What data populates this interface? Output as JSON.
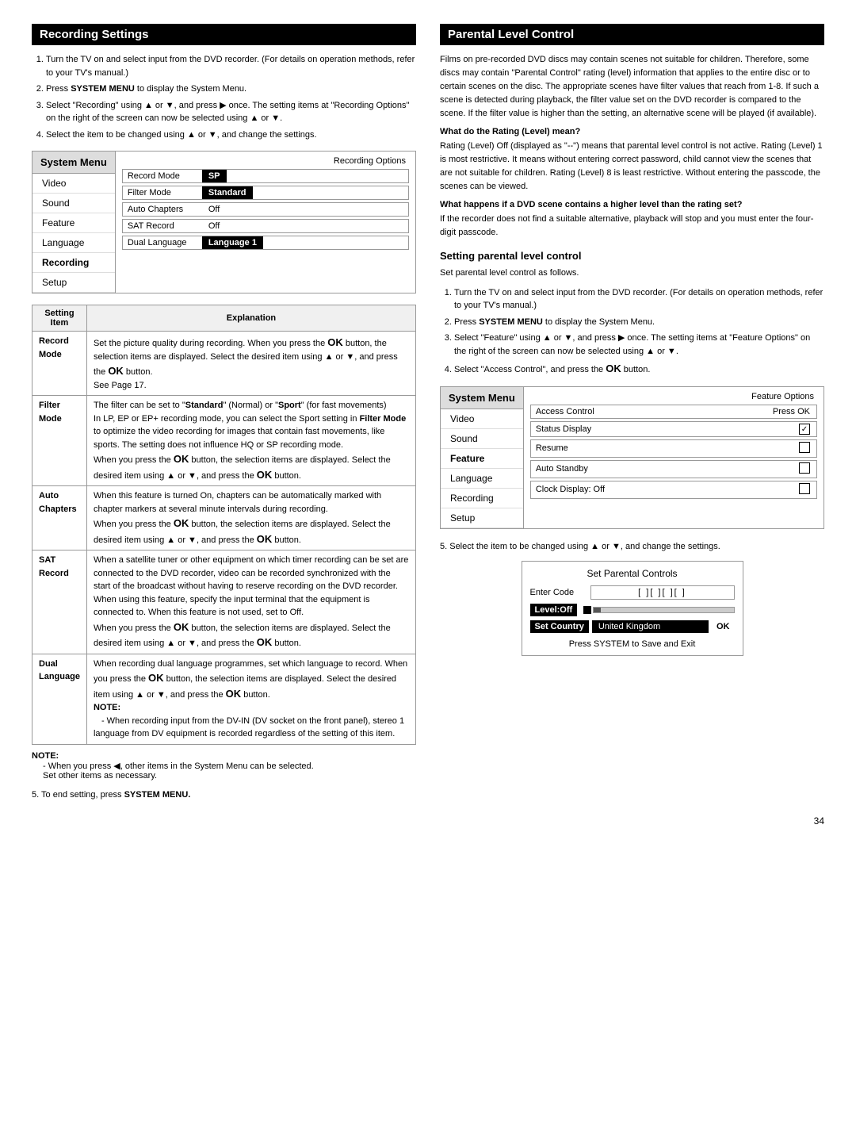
{
  "left": {
    "section_title": "Recording Settings",
    "steps": [
      "Turn the TV on and select input from the DVD recorder. (For details on operation methods, refer to your TV's manual.)",
      "Press SYSTEM MENU to display the System Menu.",
      "Select \"Recording\" using ▲ or ▼, and press ▶ once. The setting items at \"Recording Options\" on the right of the screen can now be selected using ▲ or ▼.",
      "Select the item to be changed using ▲ or ▼, and change the settings."
    ],
    "system_menu": {
      "title": "System Menu",
      "items": [
        "Video",
        "Sound",
        "Feature",
        "Language",
        "Recording",
        "Setup"
      ],
      "selected": "Recording",
      "options_title": "Recording Options",
      "options": [
        {
          "label": "Record Mode",
          "value": "SP",
          "highlighted": true
        },
        {
          "label": "Filter Mode",
          "value": "Standard",
          "highlighted": true
        },
        {
          "label": "Auto Chapters",
          "value": "Off",
          "highlighted": false
        },
        {
          "label": "SAT Record",
          "value": "Off",
          "highlighted": false
        },
        {
          "label": "Dual Language",
          "value": "Language 1",
          "highlighted": true
        }
      ]
    },
    "table": {
      "col1": "Setting Item",
      "col2": "Explanation",
      "rows": [
        {
          "item": "Record Mode",
          "explanation": "Set the picture quality during recording. When you press the OK button, the selection items are displayed. Select the desired item using ▲ or ▼, and press the OK button.\nSee Page 17."
        },
        {
          "item": "Filter Mode",
          "explanation": "The filter can be set to \"Standard\" (Normal) or \"Sport\" (for fast movements)\nIn LP, EP or EP+ recording mode, you can select the Sport setting in Filter Mode to optimize the video recording for images that contain fast movements, like sports. The setting does not influence HQ or SP recording mode.\nWhen you press the OK button, the selection items are displayed. Select the desired item using ▲ or ▼, and press the OK button."
        },
        {
          "item": "Auto Chapters",
          "explanation": "When this feature is turned On, chapters can be automatically marked with chapter markers at several minute intervals during recording.\nWhen you press the OK button, the selection items are displayed. Select the desired item using ▲ or ▼, and press the OK button."
        },
        {
          "item": "SAT Record",
          "explanation": "When a satellite tuner or other equipment on which timer recording can be set are connected to the DVD recorder, video can be recorded synchronized with the start of the broadcast without having to reserve recording on the DVD recorder. When using this feature, specify the input terminal that the equipment is connected to. When this feature is not used, set to Off.\nWhen you press the OK button, the selection items are displayed. Select the desired item using ▲ or ▼, and press the OK button."
        },
        {
          "item": "Dual Language",
          "explanation": "When recording dual language programmes, set which language to record. When you press the OK button, the selection items are displayed. Select the desired item using ▲ or ▼, and press the OK button.\nNOTE:\n- When recording input from the DV-IN (DV socket on the front panel), stereo 1 language from DV equipment is recorded regardless of the setting of this item."
        }
      ]
    },
    "note": "When you press ◀, other items in the System Menu can be selected.\nSet other items as necessary.",
    "step5": "To end setting, press SYSTEM MENU."
  },
  "right": {
    "section_title": "Parental Level Control",
    "intro": "Films on pre-recorded DVD discs may contain scenes not suitable for children. Therefore, some discs may contain \"Parental Control\" rating (level) information that applies to the entire disc or to certain scenes on the disc. The appropriate scenes have filter values that reach from 1-8. If such a scene is detected during playback, the filter value set on the DVD recorder is compared to the scene. If the filter value is higher than the setting, an alternative scene will be played (if available).",
    "q1_title": "What do the Rating (Level) mean?",
    "q1_body": "Rating (Level) Off (displayed as \"--\") means that parental level control is not active. Rating (Level) 1 is most restrictive. It means without entering correct password, child cannot view the scenes that are not suitable for children. Rating (Level) 8 is least restrictive. Without entering the passcode, the scenes can be viewed.",
    "q2_title": "What happens if a DVD scene contains a higher level than the rating set?",
    "q2_body": "If the recorder does not find a suitable alternative, playback will stop and you must enter the four-digit passcode.",
    "sub_title": "Setting parental level control",
    "sub_intro": "Set parental level control as follows.",
    "sub_steps": [
      "Turn the TV on and select input from the DVD recorder. (For details on operation methods, refer to your TV's manual.)",
      "Press SYSTEM MENU to display the System Menu.",
      "Select \"Feature\" using ▲ or ▼, and press ▶ once. The setting items at \"Feature Options\" on the right of the screen can now be selected using ▲ or ▼.",
      "Select \"Access Control\", and press the OK button."
    ],
    "feature_menu": {
      "title": "System Menu",
      "items": [
        "Video",
        "Sound",
        "Feature",
        "Language",
        "Recording",
        "Setup"
      ],
      "selected": "Feature",
      "options_title": "Feature Options",
      "options": [
        {
          "label": "Access Control",
          "value": "Press OK",
          "checkbox": "none"
        },
        {
          "label": "Status Display",
          "value": "✓",
          "checkbox": "checked"
        },
        {
          "label": "Resume",
          "value": "",
          "checkbox": "unchecked"
        },
        {
          "label": "Auto Standby",
          "value": "",
          "checkbox": "unchecked"
        },
        {
          "label": "Clock Display: Off",
          "value": "",
          "checkbox": "unchecked"
        }
      ]
    },
    "step5": "Select the item to be changed using ▲ or ▼, and change the settings.",
    "parental_controls": {
      "title": "Set Parental Controls",
      "enter_code_label": "Enter Code",
      "code_value": "[ ][ ][ ][ ]",
      "level_label": "Level:Off",
      "set_country_label": "Set Country",
      "country_value": "United Kingdom",
      "ok_label": "OK",
      "press_system": "Press SYSTEM to Save and Exit"
    }
  },
  "page_number": "34"
}
